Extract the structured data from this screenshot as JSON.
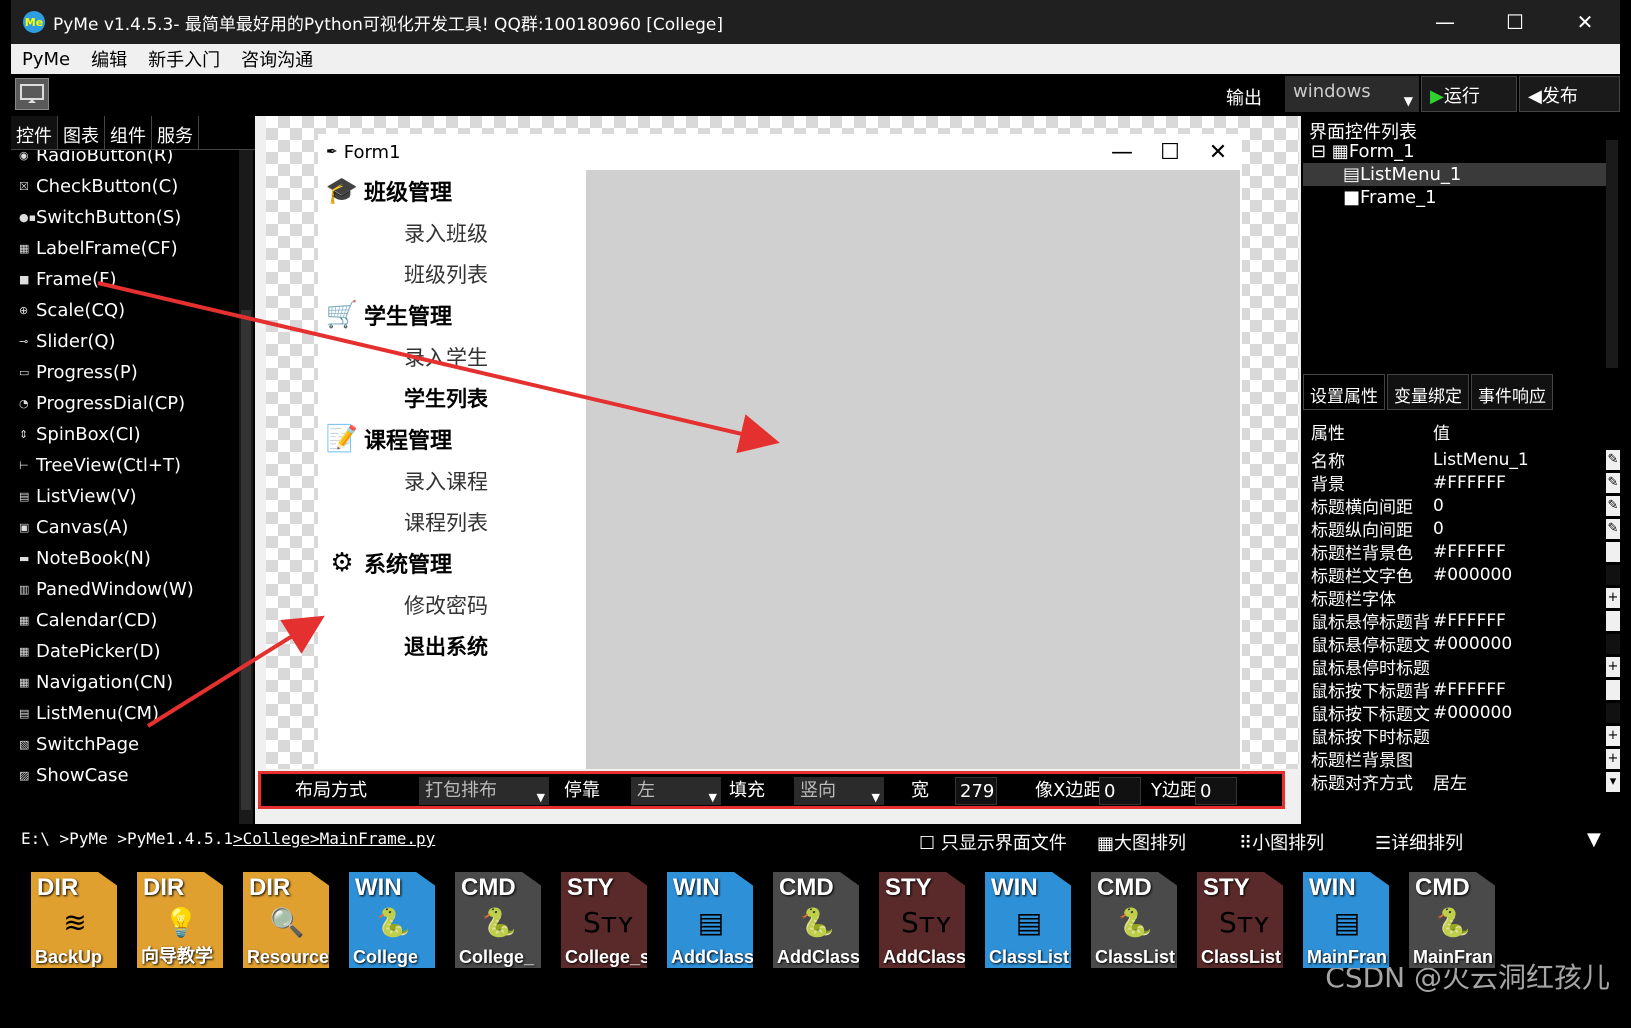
{
  "window": {
    "title": "PyMe v1.4.5.3- 最简单最好用的Python可视化开发工具! QQ群:100180960    [College]",
    "logo": "Me",
    "controls": {
      "minimize": "—",
      "maximize": "☐",
      "close": "✕"
    }
  },
  "menubar": [
    "PyMe",
    "编辑",
    "新手入门",
    "咨询沟通"
  ],
  "toolbar": {
    "output_label": "输出",
    "platform": "windows",
    "run_label": "运行",
    "publish_label": "发布"
  },
  "left_panel": {
    "tabs": [
      "控件",
      "图表",
      "组件",
      "服务"
    ],
    "components": [
      {
        "icon": "◉",
        "label": "RadioButton(R)"
      },
      {
        "icon": "☒",
        "label": "CheckButton(C)"
      },
      {
        "icon": "●▪",
        "label": "SwitchButton(S)"
      },
      {
        "icon": "▦",
        "label": "LabelFrame(CF)"
      },
      {
        "icon": "■",
        "label": "Frame(F)"
      },
      {
        "icon": "⊕",
        "label": "Scale(CQ)"
      },
      {
        "icon": "⊸",
        "label": "Slider(Q)"
      },
      {
        "icon": "▭",
        "label": "Progress(P)"
      },
      {
        "icon": "◔",
        "label": "ProgressDial(CP)"
      },
      {
        "icon": "⇕",
        "label": "SpinBox(CI)"
      },
      {
        "icon": "⊢",
        "label": "TreeView(Ctl+T)"
      },
      {
        "icon": "▤",
        "label": "ListView(V)"
      },
      {
        "icon": "▣",
        "label": "Canvas(A)"
      },
      {
        "icon": "▬",
        "label": "NoteBook(N)"
      },
      {
        "icon": "▥",
        "label": "PanedWindow(W)"
      },
      {
        "icon": "▦",
        "label": "Calendar(CD)"
      },
      {
        "icon": "▦",
        "label": "DatePicker(D)"
      },
      {
        "icon": "▦",
        "label": "Navigation(CN)"
      },
      {
        "icon": "▤",
        "label": "ListMenu(CM)"
      },
      {
        "icon": "▧",
        "label": "SwitchPage"
      },
      {
        "icon": "▨",
        "label": "ShowCase"
      }
    ]
  },
  "form": {
    "title": "Form1",
    "controls": {
      "minimize": "—",
      "maximize": "☐",
      "close": "✕"
    },
    "listmenu": [
      {
        "title": "班级管理",
        "icon": "🎓",
        "items": [
          {
            "label": "录入班级",
            "bold": false
          },
          {
            "label": "班级列表",
            "bold": false
          }
        ]
      },
      {
        "title": "学生管理",
        "icon": "🛒",
        "items": [
          {
            "label": "录入学生",
            "bold": false
          },
          {
            "label": "学生列表",
            "bold": true
          }
        ]
      },
      {
        "title": "课程管理",
        "icon": "📝",
        "items": [
          {
            "label": "录入课程",
            "bold": false
          },
          {
            "label": "课程列表",
            "bold": false
          }
        ]
      },
      {
        "title": "系统管理",
        "icon": "⚙",
        "items": [
          {
            "label": "修改密码",
            "bold": false
          },
          {
            "label": "退出系统",
            "bold": true
          }
        ]
      }
    ]
  },
  "layout_bar": {
    "layout_label": "布局方式",
    "layout_value": "打包排布",
    "dock_label": "停靠",
    "dock_value": "左",
    "fill_label": "填充",
    "fill_value": "竖向",
    "width_label": "宽",
    "width_value": "279",
    "padx_label": "像X边距",
    "padx_value": "0",
    "pady_label": "Y边距",
    "pady_value": "0"
  },
  "right_panel": {
    "title": "界面控件列表",
    "tree": [
      {
        "prefix": "⊟ ▦",
        "label": "Form_1"
      },
      {
        "prefix": "▤",
        "label": "ListMenu_1"
      },
      {
        "prefix": "■",
        "label": "Frame_1"
      }
    ],
    "tabs": [
      "设置属性",
      "变量绑定",
      "事件响应"
    ],
    "prop_header": {
      "key": "属性",
      "value": "值"
    },
    "props": [
      {
        "key": "名称",
        "value": "ListMenu_1",
        "btn": "✎"
      },
      {
        "key": "背景",
        "value": "#FFFFFF",
        "btn": "✎"
      },
      {
        "key": "标题横向间距",
        "value": "0",
        "btn": "✎"
      },
      {
        "key": "标题纵向间距",
        "value": "0",
        "btn": "✎"
      },
      {
        "key": "标题栏背景色",
        "value": "#FFFFFF",
        "btn": ""
      },
      {
        "key": "标题栏文字色",
        "value": "#000000",
        "btn": ""
      },
      {
        "key": "标题栏字体",
        "value": "",
        "btn": "+"
      },
      {
        "key": "鼠标悬停标题背",
        "value": "#FFFFFF",
        "btn": ""
      },
      {
        "key": "鼠标悬停标题文",
        "value": "#000000",
        "btn": ""
      },
      {
        "key": "鼠标悬停时标题",
        "value": "",
        "btn": "+"
      },
      {
        "key": "鼠标按下标题背",
        "value": "#FFFFFF",
        "btn": ""
      },
      {
        "key": "鼠标按下标题文",
        "value": "#000000",
        "btn": ""
      },
      {
        "key": "鼠标按下时标题",
        "value": "",
        "btn": "+"
      },
      {
        "key": "标题栏背景图",
        "value": "",
        "btn": "+"
      },
      {
        "key": "标题对齐方式",
        "value": "居左",
        "btn": "▾"
      }
    ]
  },
  "path_bar": {
    "segments": [
      "E:\\",
      ">PyMe",
      ">PyMe1.4.5.1",
      ">College",
      ">MainFrame.py"
    ],
    "only_ui_label": "☐ 只显示界面文件",
    "large_icons": "大图排列",
    "small_icons": "小图排列",
    "details": "详细排列",
    "collapse": "▼"
  },
  "files": [
    {
      "tag": "DIR",
      "label": "BackUp",
      "color": "#e0a030",
      "glyph": "≋"
    },
    {
      "tag": "DIR",
      "label": "向导教学",
      "color": "#e0a030",
      "glyph": "💡"
    },
    {
      "tag": "DIR",
      "label": "Resource",
      "color": "#e0a030",
      "glyph": "🔍"
    },
    {
      "tag": "WIN",
      "label": "College",
      "color": "#2e90d6",
      "glyph": "🐍"
    },
    {
      "tag": "CMD",
      "label": "College_",
      "color": "#4a4a4a",
      "glyph": "🐍"
    },
    {
      "tag": "STY",
      "label": "College_s",
      "color": "#5a2a2a",
      "glyph": "Sᴛʏ"
    },
    {
      "tag": "WIN",
      "label": "AddClass",
      "color": "#2e90d6",
      "glyph": "▤"
    },
    {
      "tag": "CMD",
      "label": "AddClass",
      "color": "#4a4a4a",
      "glyph": "🐍"
    },
    {
      "tag": "STY",
      "label": "AddClass",
      "color": "#5a2a2a",
      "glyph": "Sᴛʏ"
    },
    {
      "tag": "WIN",
      "label": "ClassList",
      "color": "#2e90d6",
      "glyph": "▤"
    },
    {
      "tag": "CMD",
      "label": "ClassList",
      "color": "#4a4a4a",
      "glyph": "🐍"
    },
    {
      "tag": "STY",
      "label": "ClassList",
      "color": "#5a2a2a",
      "glyph": "Sᴛʏ"
    },
    {
      "tag": "WIN",
      "label": "MainFran",
      "color": "#2e90d6",
      "glyph": "▤"
    },
    {
      "tag": "CMD",
      "label": "MainFran",
      "color": "#4a4a4a",
      "glyph": "🐍"
    }
  ],
  "watermark": "CSDN @火云洞红孩儿"
}
